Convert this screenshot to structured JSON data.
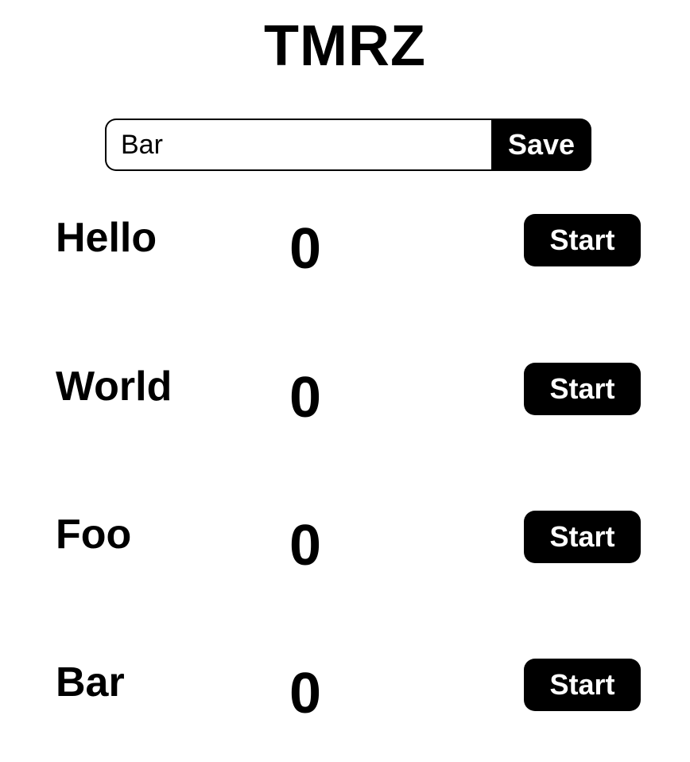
{
  "app": {
    "title": "TMRZ"
  },
  "form": {
    "input_value": "Bar",
    "save_label": "Save"
  },
  "timers": [
    {
      "name": "Hello",
      "count": "0",
      "button_label": "Start"
    },
    {
      "name": "World",
      "count": "0",
      "button_label": "Start"
    },
    {
      "name": "Foo",
      "count": "0",
      "button_label": "Start"
    },
    {
      "name": "Bar",
      "count": "0",
      "button_label": "Start"
    }
  ]
}
